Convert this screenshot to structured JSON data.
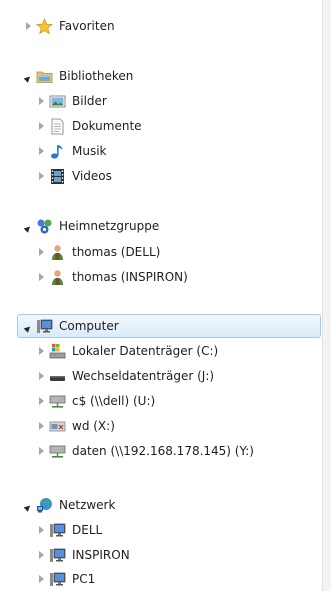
{
  "tree": {
    "favorites": {
      "label": "Favoriten"
    },
    "libraries": {
      "label": "Bibliotheken",
      "items": [
        "Bilder",
        "Dokumente",
        "Musik",
        "Videos"
      ]
    },
    "homegroup": {
      "label": "Heimnetzgruppe",
      "items": [
        "thomas (DELL)",
        "thomas (INSPIRON)"
      ]
    },
    "computer": {
      "label": "Computer",
      "items": [
        "Lokaler Datenträger (C:)",
        "Wechseldatenträger (J:)",
        "c$ (\\\\dell) (U:)",
        "wd (X:)",
        "daten (\\\\192.168.178.145) (Y:)"
      ]
    },
    "network": {
      "label": "Netzwerk",
      "items": [
        "DELL",
        "INSPIRON",
        "PC1"
      ]
    }
  },
  "colors": {
    "selection_fill": "#dbeaf9",
    "selection_border": "#a7c8ec"
  }
}
